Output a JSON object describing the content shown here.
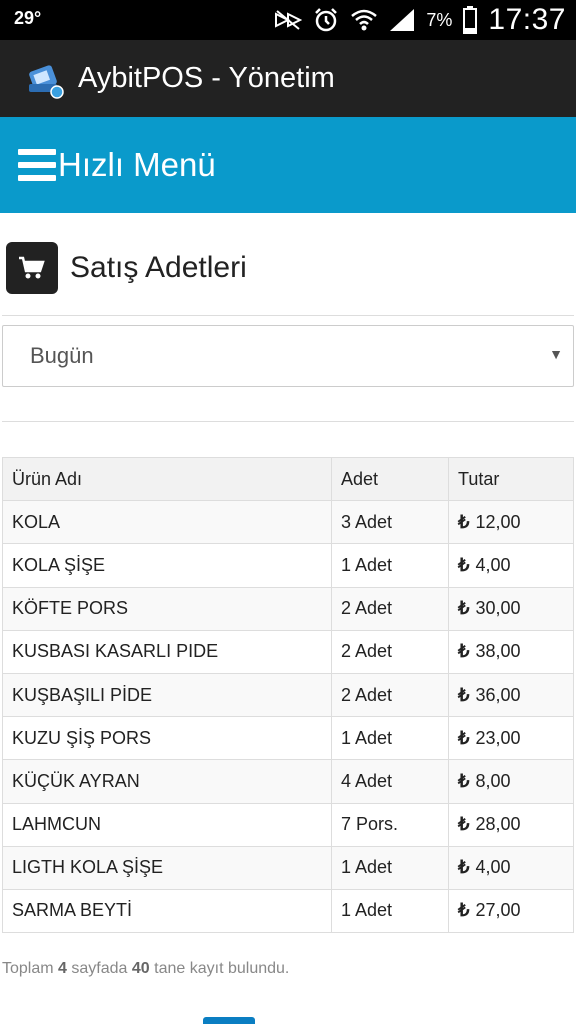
{
  "status_bar": {
    "temperature": "29°",
    "battery_percent": "7%",
    "time": "17:37",
    "icons": [
      "nfc-mute-icon",
      "alarm-icon",
      "wifi-icon",
      "signal-icon",
      "battery-icon"
    ]
  },
  "app_bar": {
    "title": "AybitPOS - Yönetim",
    "logo_icon": "pos-logo-icon"
  },
  "header": {
    "menu_title": "Hızlı Menü",
    "menu_icon": "hamburger-icon",
    "color": "#0a9acb"
  },
  "section": {
    "title": "Satış Adetleri",
    "icon": "cart-icon"
  },
  "filter": {
    "selected": "Bugün"
  },
  "table": {
    "headers": [
      "Ürün Adı",
      "Adet",
      "Tutar"
    ],
    "currency_symbol": "₺",
    "rows": [
      {
        "name": "KOLA",
        "qty": "3 Adet",
        "amount": "12,00"
      },
      {
        "name": "KOLA ŞİŞE",
        "qty": "1 Adet",
        "amount": "4,00"
      },
      {
        "name": "KÖFTE PORS",
        "qty": "2 Adet",
        "amount": "30,00"
      },
      {
        "name": "KUSBASI KASARLI PIDE",
        "qty": "2 Adet",
        "amount": "38,00"
      },
      {
        "name": "KUŞBAŞILI PİDE",
        "qty": "2 Adet",
        "amount": "36,00"
      },
      {
        "name": "KUZU ŞİŞ PORS",
        "qty": "1 Adet",
        "amount": "23,00"
      },
      {
        "name": "KÜÇÜK AYRAN",
        "qty": "4 Adet",
        "amount": "8,00"
      },
      {
        "name": "LAHMCUN",
        "qty": "7 Pors.",
        "amount": "28,00"
      },
      {
        "name": "LIGTH KOLA ŞİŞE",
        "qty": "1 Adet",
        "amount": "4,00"
      },
      {
        "name": "SARMA BEYTİ",
        "qty": "1 Adet",
        "amount": "27,00"
      }
    ]
  },
  "footer": {
    "prefix": "Toplam",
    "pages": "4",
    "middle": "sayfada",
    "records": "40",
    "suffix": "tane kayıt bulundu."
  }
}
